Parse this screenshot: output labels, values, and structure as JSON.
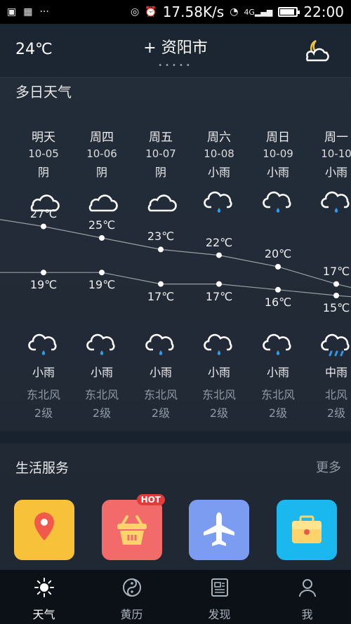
{
  "status_bar": {
    "speed": "17.58K/s",
    "time": "22:00",
    "signal": "4G",
    "battery_level": 0.9
  },
  "header": {
    "current_temp": "24℃",
    "city": "+ 资阳市",
    "dots": "•••••"
  },
  "forecast": {
    "title": "多日天气",
    "days": [
      {
        "week": "明天",
        "date": "10-05",
        "day_cond": "阴",
        "day_icon": "cloud-icon",
        "high": "27℃",
        "low": "19℃",
        "night_cond": "小雨",
        "night_icon": "rain-icon",
        "wind_dir": "东北风",
        "wind_level": "2级"
      },
      {
        "week": "周四",
        "date": "10-06",
        "day_cond": "阴",
        "day_icon": "cloud-icon",
        "high": "25℃",
        "low": "19℃",
        "night_cond": "小雨",
        "night_icon": "rain-icon",
        "wind_dir": "东北风",
        "wind_level": "2级"
      },
      {
        "week": "周五",
        "date": "10-07",
        "day_cond": "阴",
        "day_icon": "cloud-icon",
        "high": "23℃",
        "low": "17℃",
        "night_cond": "小雨",
        "night_icon": "rain-icon",
        "wind_dir": "东北风",
        "wind_level": "2级"
      },
      {
        "week": "周六",
        "date": "10-08",
        "day_cond": "小雨",
        "day_icon": "rain-icon",
        "high": "22℃",
        "low": "17℃",
        "night_cond": "小雨",
        "night_icon": "rain-icon",
        "wind_dir": "东北风",
        "wind_level": "2级"
      },
      {
        "week": "周日",
        "date": "10-09",
        "day_cond": "小雨",
        "day_icon": "rain-icon",
        "high": "20℃",
        "low": "16℃",
        "night_cond": "小雨",
        "night_icon": "rain-icon",
        "wind_dir": "东北风",
        "wind_level": "2级"
      },
      {
        "week": "周一",
        "date": "10-10",
        "day_cond": "小雨",
        "day_icon": "rain-icon",
        "high": "17℃",
        "low": "15℃",
        "night_cond": "中雨",
        "night_icon": "heavy-rain-icon",
        "wind_dir": "北风",
        "wind_level": "2级"
      }
    ]
  },
  "chart_data": {
    "type": "line",
    "categories": [
      "10-05",
      "10-06",
      "10-07",
      "10-08",
      "10-09",
      "10-10"
    ],
    "series": [
      {
        "values": [
          27,
          25,
          23,
          22,
          20,
          17
        ]
      },
      {
        "values": [
          19,
          19,
          17,
          17,
          16,
          15
        ]
      }
    ]
  },
  "services": {
    "title": "生活服务",
    "more": "更多",
    "hot_badge": "HOT",
    "items": [
      {
        "icon": "map-pin-icon",
        "color": "#f7c13a"
      },
      {
        "icon": "basket-icon",
        "color": "#f26a6a"
      },
      {
        "icon": "airplane-icon",
        "color": "#7c9cf2"
      },
      {
        "icon": "briefcase-icon",
        "color": "#1bb8f0"
      }
    ]
  },
  "nav": {
    "items": [
      {
        "label": "天气",
        "icon": "sun-icon",
        "active": true
      },
      {
        "label": "黄历",
        "icon": "yin-yang-icon",
        "active": false
      },
      {
        "label": "发现",
        "icon": "news-icon",
        "active": false
      },
      {
        "label": "我",
        "icon": "user-icon",
        "active": false
      }
    ]
  }
}
